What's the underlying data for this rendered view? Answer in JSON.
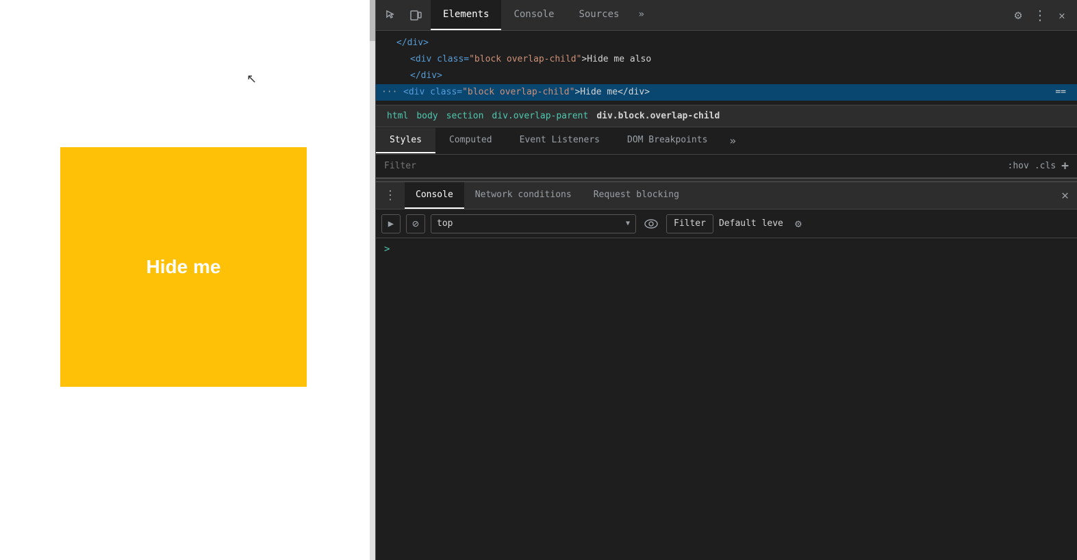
{
  "webpage": {
    "yellow_box_text": "Hide me",
    "cursor_char": "↖"
  },
  "devtools": {
    "toolbar": {
      "inspect_icon": "⊹",
      "device_icon": "⬜",
      "tabs": [
        {
          "label": "Elements",
          "active": true
        },
        {
          "label": "Console",
          "active": false
        },
        {
          "label": "Sources",
          "active": false
        }
      ],
      "more_tabs": "»",
      "settings_icon": "⚙",
      "more_icon": "⋮",
      "close_icon": "✕"
    },
    "elements": {
      "lines": [
        {
          "text": "</div>",
          "class": "tag",
          "indent": 1
        },
        {
          "indent": 2,
          "tag_open": "<div class=",
          "attr": "\"block overlap-child\"",
          "tag_text": ">Hide me also"
        },
        {
          "text": "</div>",
          "class": "tag",
          "indent": 2
        },
        {
          "tag_open": "<div class=",
          "attr": "\"block overlap-child\"",
          "tag_text": ">Hide me</div>",
          "selected": true,
          "equals": "=="
        }
      ]
    },
    "breadcrumb": {
      "items": [
        {
          "label": "html",
          "active": false
        },
        {
          "label": "body",
          "active": false
        },
        {
          "label": "section",
          "active": false
        },
        {
          "label": "div.overlap-parent",
          "active": false
        },
        {
          "label": "div.block.overlap-child",
          "active": true
        }
      ]
    },
    "inspector_tabs": [
      {
        "label": "Styles",
        "active": true
      },
      {
        "label": "Computed",
        "active": false
      },
      {
        "label": "Event Listeners",
        "active": false
      },
      {
        "label": "DOM Breakpoints",
        "active": false
      },
      {
        "label": "»",
        "active": false
      }
    ],
    "filter": {
      "placeholder": "Filter",
      "hov_label": ":hov",
      "cls_label": ".cls",
      "plus": "+"
    },
    "console_panel": {
      "tabs": [
        {
          "label": "Console",
          "active": true
        },
        {
          "label": "Network conditions",
          "active": false
        },
        {
          "label": "Request blocking",
          "active": false
        }
      ],
      "toolbar": {
        "play_icon": "▶",
        "block_icon": "⊘",
        "top_value": "top",
        "arrow_down": "▼",
        "eye_icon": "👁",
        "filter_label": "Filter",
        "default_level": "Default leve",
        "gear_icon": "⚙"
      },
      "prompt": ">",
      "close_icon": "✕",
      "menu_icon": "⋮"
    }
  }
}
